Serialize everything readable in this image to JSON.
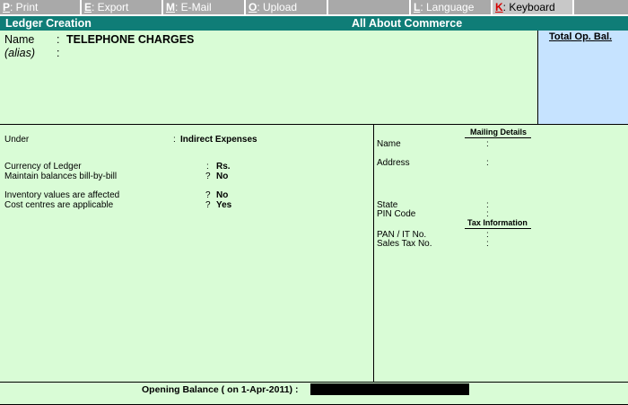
{
  "menu": {
    "items": [
      {
        "key": "P",
        "label": ": Print"
      },
      {
        "key": "E",
        "label": ": Export"
      },
      {
        "key": "M",
        "label": ": E-Mail"
      },
      {
        "key": "O",
        "label": ": Upload"
      },
      {
        "key": "",
        "label": ""
      },
      {
        "key": "L",
        "label": ": Language"
      },
      {
        "key": "K",
        "label": ": Keyboard"
      }
    ]
  },
  "header": {
    "title": "Ledger Creation",
    "company": "All About Commerce"
  },
  "ledger": {
    "name_label": "Name",
    "name_sep": ":",
    "name_value": "TELEPHONE CHARGES",
    "alias_label": "(alias)",
    "alias_sep": ":",
    "total_op_bal_label": "Total Op. Bal."
  },
  "details": {
    "under_label": "Under",
    "under_sep": ":",
    "under_value": "Indirect Expenses",
    "currency_label": "Currency of Ledger",
    "currency_sep": ":",
    "currency_value": "Rs.",
    "billwise_label": "Maintain balances bill-by-bill",
    "billwise_sep": "?",
    "billwise_value": "No",
    "inventory_label": "Inventory values are affected",
    "inventory_sep": "?",
    "inventory_value": "No",
    "cost_centres_label": "Cost centres are applicable",
    "cost_centres_sep": "?",
    "cost_centres_value": "Yes"
  },
  "mailing": {
    "title": "Mailing Details",
    "name_label": "Name",
    "address_label": "Address",
    "state_label": "State",
    "pin_label": "PIN Code",
    "sep": ":"
  },
  "tax": {
    "title": "Tax Information",
    "pan_label": "PAN / IT No.",
    "sales_tax_label": "Sales Tax No.",
    "sep": ":"
  },
  "footer": {
    "opening_balance_label": "Opening Balance  ( on 1-Apr-2011)  :"
  },
  "colors": {
    "header_bg": "#0f7d77",
    "panel_bg": "#d9fcd6",
    "total_panel_bg": "#c6e3ff",
    "menu_bg": "#a9a9a9",
    "keyboard_key": "#d40000"
  }
}
